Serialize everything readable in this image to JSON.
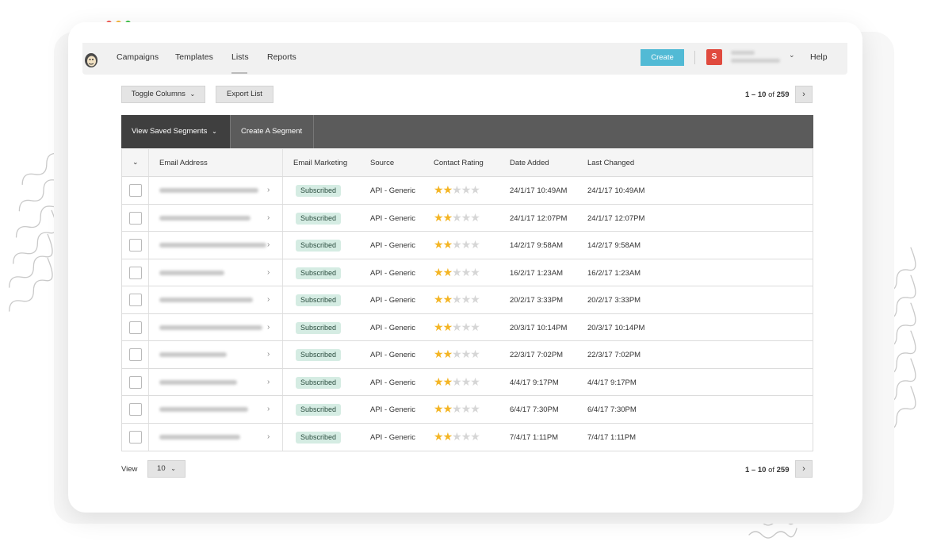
{
  "nav": {
    "items": [
      "Campaigns",
      "Templates",
      "Lists",
      "Reports"
    ],
    "create_label": "Create",
    "account_initial": "S",
    "help_label": "Help"
  },
  "toolbar": {
    "toggle_columns_label": "Toggle Columns",
    "export_list_label": "Export List"
  },
  "pager": {
    "range": "1 – 10",
    "of_label": "of",
    "total": "259"
  },
  "segments": {
    "view_saved_label": "View Saved Segments",
    "create_label": "Create A Segment"
  },
  "table": {
    "headers": {
      "email": "Email Address",
      "marketing": "Email Marketing",
      "source": "Source",
      "rating": "Contact Rating",
      "date_added": "Date Added",
      "last_changed": "Last Changed"
    },
    "rows": [
      {
        "status": "Subscribed",
        "source": "API - Generic",
        "rating": 2,
        "date_added": "24/1/17 10:49AM",
        "last_changed": "24/1/17 10:49AM"
      },
      {
        "status": "Subscribed",
        "source": "API - Generic",
        "rating": 2,
        "date_added": "24/1/17 12:07PM",
        "last_changed": "24/1/17 12:07PM"
      },
      {
        "status": "Subscribed",
        "source": "API - Generic",
        "rating": 2,
        "date_added": "14/2/17 9:58AM",
        "last_changed": "14/2/17 9:58AM"
      },
      {
        "status": "Subscribed",
        "source": "API - Generic",
        "rating": 2,
        "date_added": "16/2/17 1:23AM",
        "last_changed": "16/2/17 1:23AM"
      },
      {
        "status": "Subscribed",
        "source": "API - Generic",
        "rating": 2,
        "date_added": "20/2/17 3:33PM",
        "last_changed": "20/2/17 3:33PM"
      },
      {
        "status": "Subscribed",
        "source": "API - Generic",
        "rating": 2,
        "date_added": "20/3/17 10:14PM",
        "last_changed": "20/3/17 10:14PM"
      },
      {
        "status": "Subscribed",
        "source": "API - Generic",
        "rating": 2,
        "date_added": "22/3/17 7:02PM",
        "last_changed": "22/3/17 7:02PM"
      },
      {
        "status": "Subscribed",
        "source": "API - Generic",
        "rating": 2,
        "date_added": "4/4/17 9:17PM",
        "last_changed": "4/4/17 9:17PM"
      },
      {
        "status": "Subscribed",
        "source": "API - Generic",
        "rating": 2,
        "date_added": "6/4/17 7:30PM",
        "last_changed": "6/4/17 7:30PM"
      },
      {
        "status": "Subscribed",
        "source": "API - Generic",
        "rating": 2,
        "date_added": "7/4/17 1:11PM",
        "last_changed": "7/4/17 1:11PM"
      }
    ]
  },
  "footer": {
    "view_label": "View",
    "per_page": "10"
  },
  "colors": {
    "accent": "#52bad5",
    "avatar": "#e04a3e",
    "star": "#f4b524",
    "badge_bg": "#d5ece3"
  },
  "icons": {
    "logo": "monkey-logo-icon",
    "dropdown": "chevron-down-icon",
    "next": "chevron-right-icon",
    "row_expand": "chevron-right-icon",
    "rating": "star-icon"
  }
}
